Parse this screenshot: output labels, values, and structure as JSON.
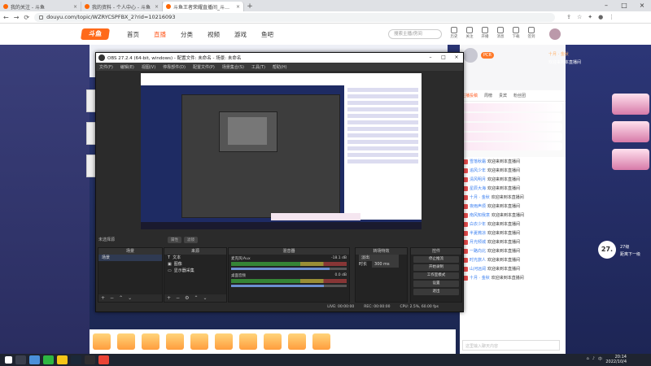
{
  "browser": {
    "tabs": [
      {
        "label": "我的关注 - 斗鱼",
        "active": false
      },
      {
        "label": "我的资料 - 个人中心 - 斗鱼",
        "active": false
      },
      {
        "label": "斗鱼王者荣耀直播间_斗鱼直播",
        "active": true
      }
    ],
    "url": "douyu.com/topic/WZRYCSPFBX_2?rid=10216093"
  },
  "site": {
    "logo": "斗鱼",
    "nav": [
      "首页",
      "直播",
      "分类",
      "视频",
      "游戏",
      "鱼吧"
    ],
    "search_placeholder": "搜索主播/房间",
    "header_icons": [
      "历史",
      "关注",
      "开播",
      "消息",
      "下载",
      "签到"
    ]
  },
  "obs": {
    "title": "OBS 27.2.4 (64-bit, windows) - 配置文件: 未命名 - 场景: 未命名",
    "menu": [
      "文件(F)",
      "编辑(E)",
      "视图(V)",
      "停靠部件(D)",
      "配置文件(P)",
      "场景集合(S)",
      "工具(T)",
      "帮助(H)"
    ],
    "scene_label": "未选择源",
    "scene_buttons": [
      "属性",
      "滤镜"
    ],
    "docks": {
      "scenes": {
        "title": "场景",
        "items": [
          "场景"
        ]
      },
      "sources": {
        "title": "来源",
        "items": [
          "文本",
          "图像",
          "显示器采集"
        ]
      },
      "mixer": {
        "title": "混音器",
        "tracks": [
          {
            "name": "麦克风/Aux",
            "db": "-18.1 dB"
          },
          {
            "name": "桌面音频",
            "db": "0.0 dB"
          }
        ]
      },
      "transitions": {
        "title": "转场特效",
        "type": "淡出",
        "duration_label": "时长",
        "duration": "300 ms"
      },
      "controls": {
        "title": "控件",
        "buttons": [
          "停止推流",
          "开始录制",
          "工作室模式",
          "设置",
          "退出"
        ]
      }
    },
    "status": {
      "live": "LIVE: 00:00:00",
      "rec": "REC: 00:00:00",
      "cpu": "CPU: 2.5%, 60.00 fps"
    }
  },
  "chat": {
    "tabs": [
      "主播投稿",
      "周榜",
      "贵宾",
      "粉丝团"
    ],
    "welcome": "欢迎来到本直播间",
    "rows": [
      {
        "name": "雪落秋霜",
        "msg": "欢迎来到本直播间"
      },
      {
        "name": "追风少年",
        "msg": "欢迎来到本直播间"
      },
      {
        "name": "清风明月",
        "msg": "欢迎来到本直播间"
      },
      {
        "name": "星辰大海",
        "msg": "欢迎来到本直播间"
      },
      {
        "name": "十月 · 金秋",
        "msg": "欢迎来到本直播间"
      },
      {
        "name": "夜雨声烦",
        "msg": "欢迎来到本直播间"
      },
      {
        "name": "南风知我意",
        "msg": "欢迎来到本直播间"
      },
      {
        "name": "白衣少年",
        "msg": "欢迎来到本直播间"
      },
      {
        "name": "半夏微凉",
        "msg": "欢迎来到本直播间"
      },
      {
        "name": "月光倾城",
        "msg": "欢迎来到本直播间"
      },
      {
        "name": "一路向北",
        "msg": "欢迎来到本直播间"
      },
      {
        "name": "时光旅人",
        "msg": "欢迎来到本直播间"
      },
      {
        "name": "山河远阔",
        "msg": "欢迎来到本直播间"
      },
      {
        "name": "十月 · 金秋",
        "msg": "欢迎来到本直播间"
      }
    ],
    "input_placeholder": "这里输入聊天内容"
  },
  "announcement": {
    "line1": "十月 · 金秋",
    "line2": "欢迎来到本直播间"
  },
  "level_badge": {
    "value": "27.",
    "line1": "27级",
    "line2": "距离下一级"
  },
  "clock": {
    "time": "20:14",
    "date": "2022/10/4"
  },
  "colors": {
    "accent": "#ff5d23",
    "page_bg": "#233063",
    "obs_bg": "#2b2b2b"
  }
}
